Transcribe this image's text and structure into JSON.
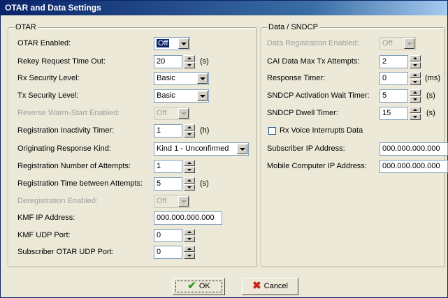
{
  "window": {
    "title": "OTAR and Data Settings"
  },
  "otar": {
    "group_title": "OTAR",
    "otar_enabled": {
      "label": "OTAR Enabled:",
      "value": "Off"
    },
    "rekey_timeout": {
      "label": "Rekey Request Time Out:",
      "value": "20",
      "unit": "(s)"
    },
    "rx_security": {
      "label": "Rx Security Level:",
      "value": "Basic"
    },
    "tx_security": {
      "label": "Tx Security Level:",
      "value": "Basic"
    },
    "reverse_warm_start": {
      "label": "Reverse Warm-Start Enabled:",
      "value": "Off"
    },
    "reg_inactivity": {
      "label": "Registration Inactivity Timer:",
      "value": "1",
      "unit": "(h)"
    },
    "orig_response": {
      "label": "Originating Response Kind:",
      "value": "Kind 1 - Unconfirmed"
    },
    "reg_attempts": {
      "label": "Registration Number of Attempts:",
      "value": "1"
    },
    "reg_time_between": {
      "label": "Registration Time between Attempts:",
      "value": "5",
      "unit": "(s)"
    },
    "dereg_enabled": {
      "label": "Deregistration Enabled:",
      "value": "Off"
    },
    "kmf_ip": {
      "label": "KMF IP Address:",
      "value": "000.000.000.000"
    },
    "kmf_udp": {
      "label": "KMF UDP Port:",
      "value": "0"
    },
    "sub_otar_udp": {
      "label": "Subscriber OTAR UDP Port:",
      "value": "0"
    }
  },
  "data": {
    "group_title": "Data / SNDCP",
    "data_reg_enabled": {
      "label": "Data Registration Enabled:",
      "value": "Off"
    },
    "cai_max_tx": {
      "label": "CAI Data Max Tx Attempts:",
      "value": "2"
    },
    "response_timer": {
      "label": "Response Timer:",
      "value": "0",
      "unit": "(ms)"
    },
    "sndcp_activation": {
      "label": "SNDCP Activation Wait Timer:",
      "value": "5",
      "unit": "(s)"
    },
    "sndcp_dwell": {
      "label": "SNDCP Dwell Timer:",
      "value": "15",
      "unit": "(s)"
    },
    "rx_voice_interrupts": {
      "label": "Rx Voice Interrupts Data",
      "checked": false
    },
    "subscriber_ip": {
      "label": "Subscriber IP Address:",
      "value": "000.000.000.000"
    },
    "mobile_ip": {
      "label": "Mobile Computer IP Address:",
      "value": "000.000.000.000"
    }
  },
  "buttons": {
    "ok": "OK",
    "cancel": "Cancel"
  }
}
